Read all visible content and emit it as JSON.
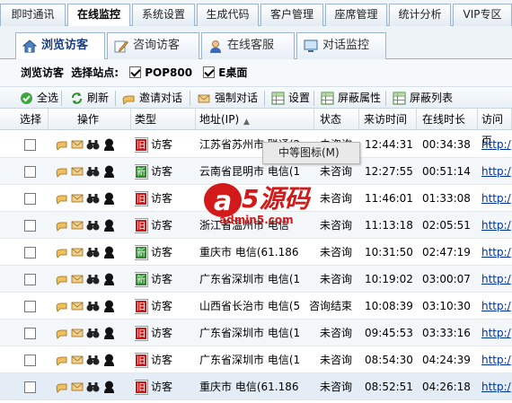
{
  "top_tabs": [
    "即时通讯",
    "在线监控",
    "系统设置",
    "生成代码",
    "客户管理",
    "座席管理",
    "统计分析",
    "VIP专区"
  ],
  "sub_tabs": [
    "浏览访客",
    "咨询访客",
    "在线客服",
    "对话监控"
  ],
  "site_bar": {
    "label1": "浏览访客",
    "label2": "选择站点:",
    "site1": "POP800",
    "site2": "E桌面"
  },
  "toolbar": [
    "全选",
    "刷新",
    "邀请对话",
    "强制对话",
    "设置",
    "屏蔽属性",
    "屏蔽列表"
  ],
  "columns": [
    "选择",
    "操作",
    "类型",
    "地址(IP)",
    "状态",
    "来访时间",
    "在线时长",
    "访问页"
  ],
  "rows": [
    {
      "badge": "旧",
      "type": "访客",
      "addr": "江苏省苏州市 联通(2",
      "status": "未咨询",
      "time": "12:44:31",
      "dur": "00:34:38",
      "page": "http:/"
    },
    {
      "badge": "新",
      "type": "访客",
      "addr": "云南省昆明市 电信(1",
      "status": "未咨询",
      "time": "12:27:55",
      "dur": "00:51:14",
      "page": "http:/"
    },
    {
      "badge": "旧",
      "type": "访客",
      "addr": "",
      "status": "未咨询",
      "time": "11:46:01",
      "dur": "01:33:08",
      "page": "http:/"
    },
    {
      "badge": "旧",
      "type": "访客",
      "addr": "浙江省温州市 电信",
      "status": "未咨询",
      "time": "11:13:18",
      "dur": "02:05:51",
      "page": "http:/"
    },
    {
      "badge": "新",
      "type": "访客",
      "addr": "重庆市 电信(61.186",
      "status": "未咨询",
      "time": "10:31:50",
      "dur": "02:47:19",
      "page": "http:/"
    },
    {
      "badge": "新",
      "type": "访客",
      "addr": "广东省深圳市 电信(1",
      "status": "未咨询",
      "time": "10:19:02",
      "dur": "03:00:07",
      "page": "http:/"
    },
    {
      "badge": "旧",
      "type": "访客",
      "addr": "山西省长治市 电信(5",
      "status": "咨询结束",
      "time": "10:08:39",
      "dur": "03:10:30",
      "page": "http:/"
    },
    {
      "badge": "旧",
      "type": "访客",
      "addr": "广东省深圳市 电信(1",
      "status": "未咨询",
      "time": "09:45:53",
      "dur": "03:33:16",
      "page": "http:/"
    },
    {
      "badge": "旧",
      "type": "访客",
      "addr": "广东省深圳市 电信(1",
      "status": "未咨询",
      "time": "08:54:30",
      "dur": "04:24:39",
      "page": "http:/"
    },
    {
      "badge": "旧",
      "type": "访客",
      "addr": "重庆市 电信(61.186",
      "status": "未咨询",
      "time": "08:52:51",
      "dur": "04:26:18",
      "page": "http:/"
    }
  ],
  "tooltip": "中等图标(M)",
  "watermark": {
    "big": "a5源码",
    "small": "admin5.com"
  }
}
